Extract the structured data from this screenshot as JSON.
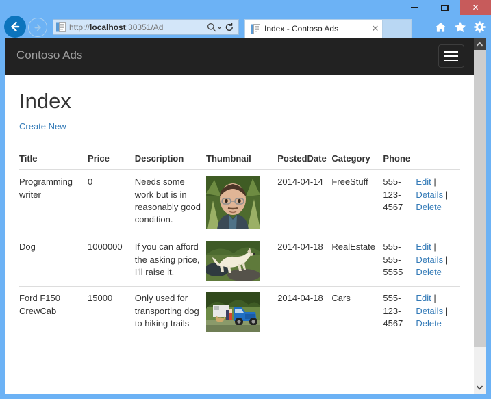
{
  "window": {
    "controls": {
      "minimize_label": "Minimize",
      "maximize_label": "Maximize",
      "close_label": "✕"
    },
    "frame_color": "#6cb2f5",
    "close_color": "#c75b5b"
  },
  "browser": {
    "back_label": "Back",
    "forward_label": "Forward",
    "address": {
      "scheme": "http://",
      "host": "localhost",
      "rest": ":30351/Ad",
      "full_url": "http://localhost:30351/Ad",
      "search_icon": "search-icon",
      "dropdown_icon": "chevron-down-icon",
      "refresh_icon": "refresh-icon"
    },
    "tabs": [
      {
        "title": "Index - Contoso Ads",
        "favicon": "page-icon",
        "close_label": "✕",
        "active": true
      }
    ],
    "new_tab_label": "New tab",
    "tools": [
      {
        "name": "home-icon",
        "label": "Home"
      },
      {
        "name": "favorites-star-icon",
        "label": "Favorites"
      },
      {
        "name": "settings-gear-icon",
        "label": "Tools"
      }
    ]
  },
  "site": {
    "navbar": {
      "brand": "Contoso Ads",
      "toggle_label": "Toggle navigation",
      "background": "#222222",
      "brand_color": "#9d9d9d"
    },
    "page_title": "Index",
    "create_new_label": "Create New",
    "link_color": "#337ab7"
  },
  "table": {
    "columns": [
      "Title",
      "Price",
      "Description",
      "Thumbnail",
      "PostedDate",
      "Category",
      "Phone",
      ""
    ],
    "rows": [
      {
        "title": "Programming writer",
        "price": "0",
        "description": "Needs some work but is in reasonably good condition.",
        "thumbnail_alt": "portrait-thumbnail",
        "posted_date": "2014-04-14",
        "category": "FreeStuff",
        "phone": "555-123-4567",
        "actions": {
          "edit": "Edit",
          "sep1": "|",
          "details": "Details",
          "sep2": "|",
          "delete": "Delete"
        }
      },
      {
        "title": "Dog",
        "price": "1000000",
        "description": "If you can afford the asking price, I'll raise it.",
        "thumbnail_alt": "dog-thumbnail",
        "posted_date": "2014-04-18",
        "category": "RealEstate",
        "phone": "555-555-5555",
        "actions": {
          "edit": "Edit",
          "sep1": "|",
          "details": "Details",
          "sep2": "|",
          "delete": "Delete"
        }
      },
      {
        "title": "Ford F150 CrewCab",
        "price": "15000",
        "description": "Only used for transporting dog to hiking trails",
        "thumbnail_alt": "truck-thumbnail",
        "posted_date": "2014-04-18",
        "category": "Cars",
        "phone": "555-123-4567",
        "actions": {
          "edit": "Edit",
          "sep1": "|",
          "details": "Details",
          "sep2": "|",
          "delete": "Delete"
        }
      }
    ]
  },
  "scrollbar": {
    "up_icon": "chevron-up-icon",
    "down_icon": "chevron-down-icon"
  }
}
